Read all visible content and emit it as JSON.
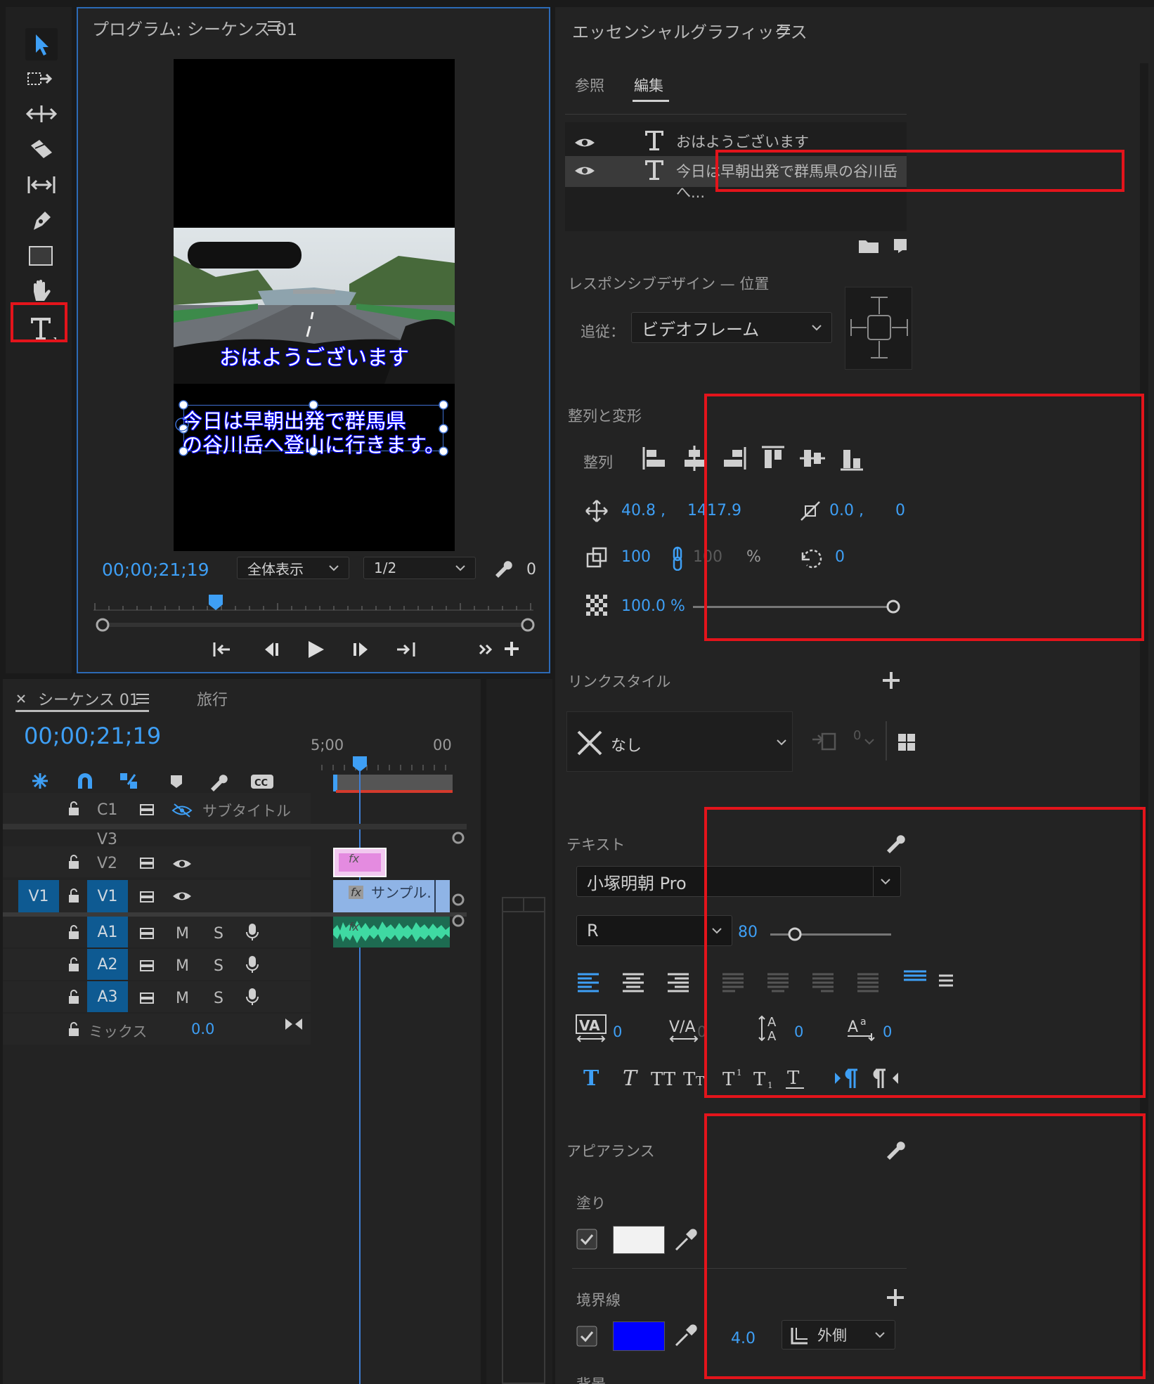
{
  "tools": {
    "items": [
      "selection-tool",
      "track-select-tool",
      "ripple-edit-tool",
      "razor-tool",
      "slip-tool",
      "pen-tool",
      "rectangle-tool",
      "hand-tool",
      "type-tool"
    ]
  },
  "program": {
    "title": "プログラム: シーケンス 01",
    "caption_top": "おはようございます",
    "caption_line1": "今日は早朝出発で群馬県",
    "caption_line2": "の谷川岳へ登山に行きます。",
    "timecode": "00;00;21;19",
    "zoom_select": "全体表示",
    "resolution_select": "1/2",
    "count": "0"
  },
  "essential_graphics": {
    "title": "エッセンシャルグラフィックス",
    "tabs": [
      "参照",
      "編集"
    ],
    "active_tab": "編集",
    "layers": [
      {
        "name": "おはようございます"
      },
      {
        "name": "今日は早朝出発で群馬県の谷川岳へ..."
      }
    ],
    "responsive": {
      "label": "レスポンシブデザイン — 位置",
      "follow_label": "追従：",
      "follow_value": "ビデオフレーム"
    },
    "align": {
      "section_title": "整列と変形",
      "align_label": "整列",
      "pos_x": "40.8 ,",
      "pos_y": "1417.9",
      "anchor_x": "0.0 ,",
      "anchor_y": "0.0",
      "scale": "100",
      "scale_locked": "100",
      "percent": "%",
      "rotation": "0",
      "opacity": "100.0 %"
    },
    "link_style": {
      "title": "リンクスタイル",
      "value": "なし",
      "count": "0"
    },
    "text": {
      "title": "テキスト",
      "font": "小塚明朝 Pro",
      "style": "R",
      "size": "80",
      "tracking": "0",
      "kerning": "0",
      "leading": "0",
      "baseline": "0"
    },
    "appearance": {
      "title": "アピアランス",
      "fill_label": "塗り",
      "fill_color": "#f2f2f2",
      "stroke_label": "境界線",
      "stroke_color": "#0000ff",
      "stroke_width": "4.0",
      "stroke_type": "外側",
      "background_label": "背景"
    }
  },
  "timeline": {
    "tab_title": "シーケンス 01",
    "other_tab": "旅行",
    "timecode": "00;00;21;19",
    "ruler_start": "5;00",
    "ruler_end": "00",
    "subtitle_label": "サブタイトル",
    "clip_label": "サンプル.",
    "tracks": {
      "c1": "C1",
      "v3": "V3",
      "v2": "V2",
      "v1": "V1",
      "v1_src": "V1",
      "a1": "A1",
      "a2": "A2",
      "a3": "A3"
    },
    "mute": "M",
    "solo": "S",
    "mix_label": "ミックス",
    "mix_value": "0.0"
  },
  "colors": {
    "accent": "#3e9ff5",
    "highlight_red": "#e3141b",
    "track_blue": "#0e5a92",
    "clip_pink": "#e08ae0",
    "clip_blue": "#8fb4e6",
    "audio_green": "#2fbf8a"
  }
}
